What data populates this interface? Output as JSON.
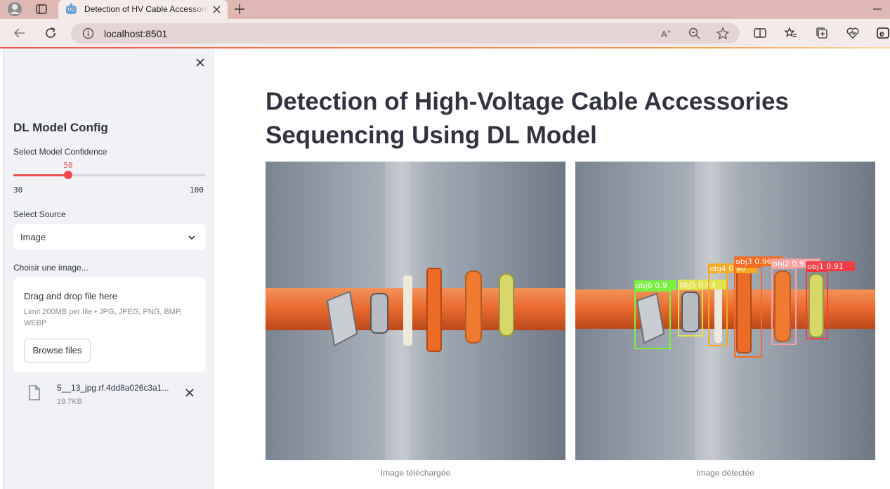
{
  "browser": {
    "tab_title": "Detection of HV Cable Accessories",
    "url": "localhost:8501"
  },
  "sidebar": {
    "heading": "DL Model Config",
    "confidence": {
      "label": "Select Model Confidence",
      "value": 50,
      "value_text": "50",
      "min": 30,
      "min_text": "30",
      "max": 100,
      "max_text": "100"
    },
    "source": {
      "label": "Select Source",
      "selected": "Image"
    },
    "uploader": {
      "label": "Choisir une image...",
      "drop_text": "Drag and drop file here",
      "limit_text": "Limit 200MB per file • JPG, JPEG, PNG, BMP, WEBP",
      "browse_label": "Browse files",
      "file_name": "5__13_jpg.rf.4dd8a026c3a1...",
      "file_size": "19.7KB"
    }
  },
  "main": {
    "title": "Detection of High-Voltage Cable Accessories Sequencing Using DL Model",
    "uploaded_caption": "Image téléchargée",
    "detected_caption": "Image détectée",
    "detections": [
      {
        "label": "obj6 0.9",
        "color": "#7bf13f"
      },
      {
        "label": "obj5 0.93",
        "color": "#e1e44f"
      },
      {
        "label": "obj4 0.90",
        "color": "#f6a923"
      },
      {
        "label": "obj3 0.96",
        "color": "#f46b21"
      },
      {
        "label": "obj2 0.92",
        "color": "#f5a3a3"
      },
      {
        "label": "obj1 0.91",
        "color": "#f03d46"
      }
    ]
  },
  "colors": {
    "accent": "#ef4a4b",
    "chrome": "#dfb8b4",
    "sidebar_bg": "#f0f2f6",
    "cable": "#e8682d"
  }
}
